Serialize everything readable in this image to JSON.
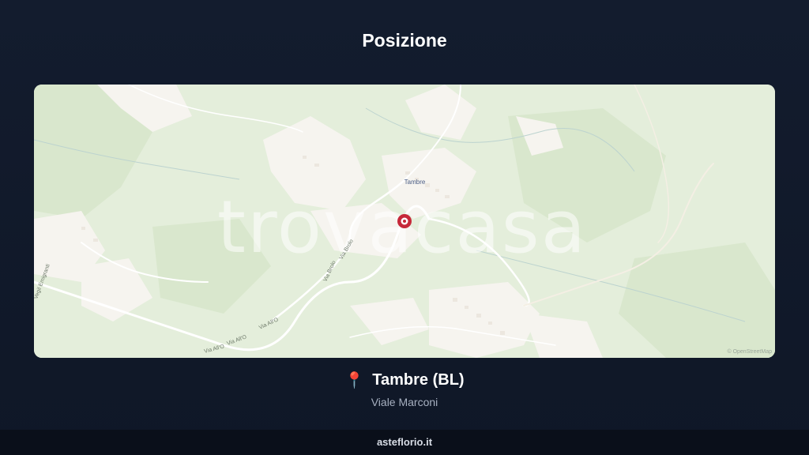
{
  "page": {
    "title": "Posizione"
  },
  "map": {
    "watermark": "trovacasa",
    "town_label": "Tambre",
    "street_labels": [
      "Via Brolo",
      "Via Brolo",
      "Via All'O",
      "Via All'O",
      "Via All'O",
      "Vegil Emigranti"
    ],
    "attribution": "© OpenStreetMap",
    "marker_color": "#c62839",
    "colors": {
      "background": "#e4eedb",
      "built_area": "#f7f5f1",
      "forest": "#dce9d0",
      "road": "#ffffff"
    }
  },
  "location": {
    "pin_icon": "round-pushpin-icon",
    "name": "Tambre (BL)",
    "street": "Viale Marconi"
  },
  "footer": {
    "site": "asteflorio.it"
  }
}
